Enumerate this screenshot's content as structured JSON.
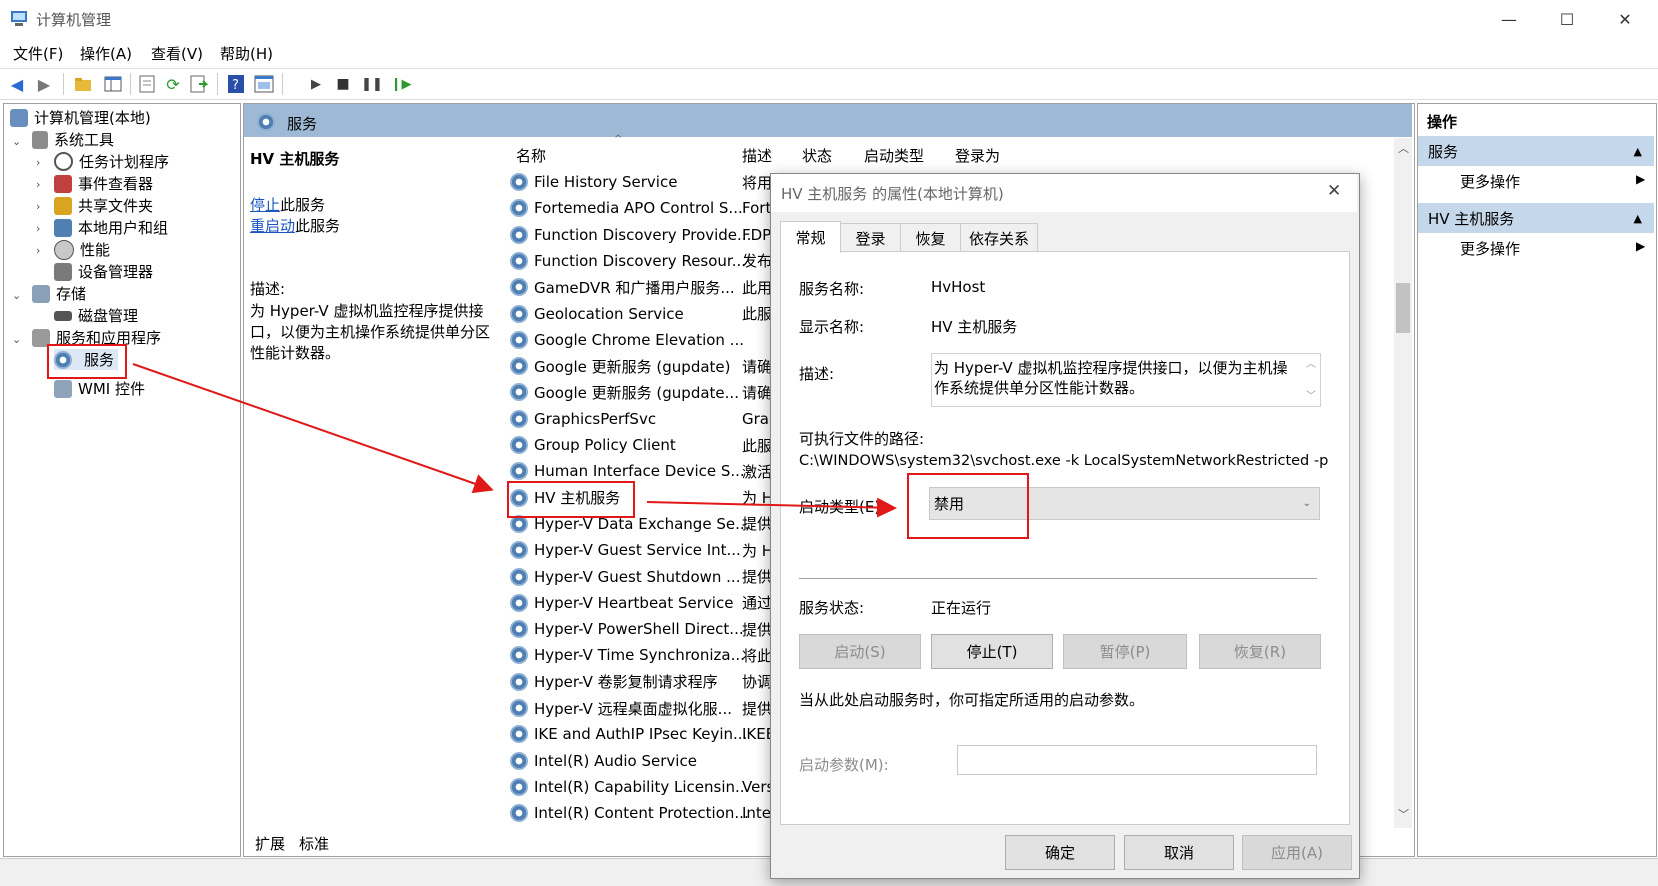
{
  "window": {
    "title": "计算机管理"
  },
  "menu": [
    "文件(F)",
    "操作(A)",
    "查看(V)",
    "帮助(H)"
  ],
  "tree": {
    "root": "计算机管理(本地)",
    "system_tools": "系统工具",
    "task_scheduler": "任务计划程序",
    "event_viewer": "事件查看器",
    "shared_folders": "共享文件夹",
    "local_users": "本地用户和组",
    "performance": "性能",
    "device_manager": "设备管理器",
    "storage": "存储",
    "disk_management": "磁盘管理",
    "services_apps": "服务和应用程序",
    "services": "服务",
    "wmi": "WMI 控件"
  },
  "center": {
    "header_title": "服务",
    "selected_title": "HV 主机服务",
    "stop_link": "停止",
    "stop_suffix": "此服务",
    "restart_link": "重启动",
    "restart_suffix": "此服务",
    "desc_label": "描述:",
    "desc_line1": "为 Hyper-V 虚拟机监控程序提供接",
    "desc_line2": "口，以便为主机操作系统提供单分区",
    "desc_line3": "性能计数器。",
    "columns": {
      "name": "名称",
      "desc": "描述",
      "status": "状态",
      "startup": "启动类型",
      "logon": "登录为"
    },
    "rows": [
      {
        "name": "File History Service",
        "desc": "将用"
      },
      {
        "name": "Fortemedia APO Control S...",
        "desc": "Forte"
      },
      {
        "name": "Function Discovery Provide...",
        "desc": "FDP"
      },
      {
        "name": "Function Discovery Resour...",
        "desc": "发布"
      },
      {
        "name": "GameDVR 和广播用户服务...",
        "desc": "此用"
      },
      {
        "name": "Geolocation Service",
        "desc": "此服"
      },
      {
        "name": "Google Chrome Elevation ...",
        "desc": ""
      },
      {
        "name": "Google 更新服务 (gupdate)",
        "desc": "请确"
      },
      {
        "name": "Google 更新服务 (gupdate...",
        "desc": "请确"
      },
      {
        "name": "GraphicsPerfSvc",
        "desc": "Grap"
      },
      {
        "name": "Group Policy Client",
        "desc": "此服"
      },
      {
        "name": "Human Interface Device S...",
        "desc": "激活"
      },
      {
        "name": "HV 主机服务",
        "desc": "为 H"
      },
      {
        "name": "Hyper-V Data Exchange Se...",
        "desc": "提供"
      },
      {
        "name": "Hyper-V Guest Service Int...",
        "desc": "为 H"
      },
      {
        "name": "Hyper-V Guest Shutdown ...",
        "desc": "提供"
      },
      {
        "name": "Hyper-V Heartbeat Service",
        "desc": "通过"
      },
      {
        "name": "Hyper-V PowerShell Direct...",
        "desc": "提供"
      },
      {
        "name": "Hyper-V Time Synchroniza...",
        "desc": "将此"
      },
      {
        "name": "Hyper-V 卷影复制请求程序",
        "desc": "协调"
      },
      {
        "name": "Hyper-V 远程桌面虚拟化服...",
        "desc": "提供"
      },
      {
        "name": "IKE and AuthIP IPsec Keyin...",
        "desc": "IKEE"
      },
      {
        "name": "Intel(R) Audio Service",
        "desc": ""
      },
      {
        "name": "Intel(R) Capability Licensin...",
        "desc": "Vers"
      },
      {
        "name": "Intel(R) Content Protection...",
        "desc": "Intel"
      }
    ],
    "tab_extended": "扩展",
    "tab_standard": "标准"
  },
  "actions": {
    "title": "操作",
    "section1": "服务",
    "more1": "更多操作",
    "section2": "HV 主机服务",
    "more2": "更多操作"
  },
  "dialog": {
    "title": "HV 主机服务 的属性(本地计算机)",
    "tabs": [
      "常规",
      "登录",
      "恢复",
      "依存关系"
    ],
    "service_name_label": "服务名称:",
    "service_name": "HvHost",
    "display_name_label": "显示名称:",
    "display_name": "HV 主机服务",
    "desc_label": "描述:",
    "desc_line1": "为 Hyper-V 虚拟机监控程序提供接口，以便为主机操",
    "desc_line2": "作系统提供单分区性能计数器。",
    "path_label": "可执行文件的路径:",
    "path": "C:\\WINDOWS\\system32\\svchost.exe -k LocalSystemNetworkRestricted -p",
    "startup_type_label": "启动类型(E):",
    "startup_type": "禁用",
    "status_label": "服务状态:",
    "status": "正在运行",
    "btn_start": "启动(S)",
    "btn_stop": "停止(T)",
    "btn_pause": "暂停(P)",
    "btn_resume": "恢复(R)",
    "hint": "当从此处启动服务时，你可指定所适用的启动参数。",
    "params_label": "启动参数(M):",
    "params_value": "",
    "ok": "确定",
    "cancel": "取消",
    "apply": "应用(A)"
  },
  "colors": {
    "accent": "#9db9d6",
    "annotation": "#e01818",
    "link": "#1a55c0"
  }
}
